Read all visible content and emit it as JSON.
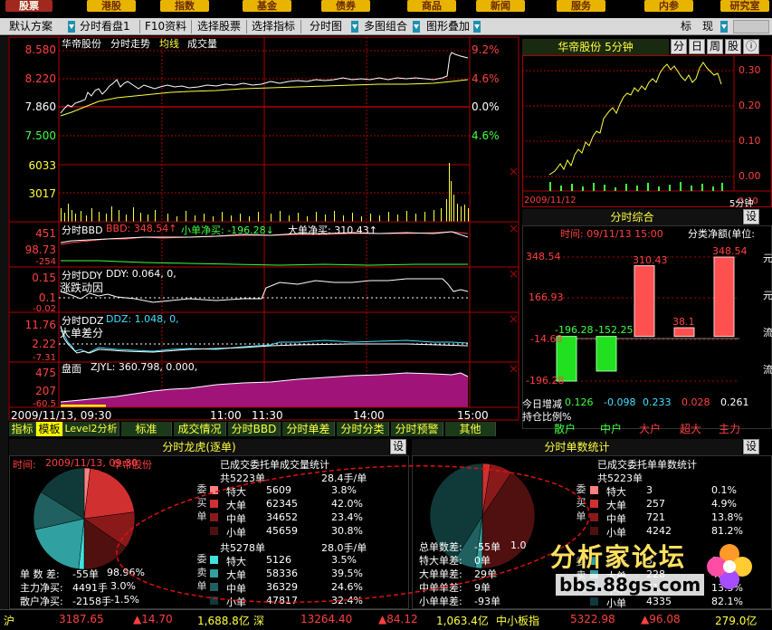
{
  "menubar": {
    "items": [
      "股票",
      "港股",
      "指数",
      "基金",
      "债券",
      "商品",
      "新闻",
      "服务",
      "内参",
      "研究室"
    ],
    "active": 0
  },
  "toolbar": {
    "scheme": "默认方案",
    "items": [
      "分时看盘1",
      "F10资料",
      "选择股票",
      "选择指标",
      "分时图",
      "多图组合",
      "图形叠加"
    ],
    "right_buttons": [
      "标",
      "现"
    ]
  },
  "main_chart": {
    "title": "华帝股份",
    "mode": "分时走势",
    "avg_label": "均线",
    "vol_label": "成交量",
    "price_labels": [
      "8.580",
      "8.220",
      "7.860",
      "7.500"
    ],
    "pct_labels": [
      "9.2%",
      "4.6%",
      "0.0%",
      "4.6%"
    ],
    "vol_labels": [
      "6033",
      "3017"
    ],
    "colors": {
      "price_line": "#ffffff",
      "avg_line": "#ffff40",
      "axis_red": "#b00000",
      "up": "#ff4040",
      "down": "#40ff40"
    }
  },
  "bbd": {
    "label": "分时BBD",
    "bbd_text": "BBD: 348.54↑",
    "small_text": "小单净买: -196.28↓",
    "big_text": "大单净买: 310.43↑",
    "y_labels": [
      "451",
      "98.73",
      "-254"
    ]
  },
  "ddy": {
    "label": "分时DDY",
    "value_text": "DDY: 0.064, 0,",
    "sub_title": "涨跌动因",
    "y_labels": [
      "0.15",
      "0.1",
      "-0.02"
    ]
  },
  "ddz": {
    "label": "分时DDZ",
    "value_text": "DDZ: 1.048, 0,",
    "sub_title": "大单差分",
    "y_labels": [
      "11.76",
      "2.22",
      "-7.31"
    ]
  },
  "pan": {
    "label": "盘面",
    "value_text": "ZJYL: 360.798, 0.000,",
    "y_labels": [
      "475",
      "207",
      "-60.5"
    ]
  },
  "time_axis": {
    "date": "2009/11/13, 09:30",
    "ticks": [
      "11:00",
      "11:30",
      "14:00",
      "15:00"
    ]
  },
  "tabs": [
    "指标",
    "模板",
    "Level2分析",
    "标准",
    "成交情况",
    "分时BBD",
    "分时单差",
    "分时分类",
    "分时预警",
    "其他"
  ],
  "active_tab": 1,
  "right_top": {
    "title": "华帝股份  5分钟",
    "buttons": [
      "分",
      "日",
      "周",
      "股",
      "ⓘ"
    ],
    "y_labels": [
      "0.30",
      "0.20",
      "0.10",
      "0.00",
      "-0.10"
    ],
    "date": "2009/11/12",
    "period": "5分钟"
  },
  "right_mid": {
    "title": "分时综合",
    "set": "设",
    "time_text": "时间: 09/11/13 15:00",
    "unit_text": "分类净额(单位:",
    "y_labels": [
      "348.54",
      "166.93",
      "-14.68",
      "-196.28"
    ],
    "side_chars": [
      "元",
      "元",
      "流",
      "流"
    ],
    "values_bars": [
      -196.28,
      -152.25,
      310.43,
      38.1,
      348.54
    ],
    "bar_labels": [
      "-196.28",
      "-152.25",
      "310.43",
      "38.1",
      "348.54"
    ],
    "increase_label": "今日增减",
    "increase_values": [
      "0.126",
      "-0.098",
      "0.233",
      "0.028",
      "0.261"
    ],
    "hold_label": "持仓比例%",
    "categories": [
      "散户",
      "中户",
      "大户",
      "超大",
      "主力"
    ]
  },
  "dragon": {
    "title": "分时龙虎(逐单)",
    "set": "设",
    "time_label": "时间:",
    "time_value": "2009/11/13, 09:30",
    "stock": "华帝股份",
    "pie_slices": [
      {
        "name": "特大",
        "pct": 3.8,
        "color": "#ff8080"
      },
      {
        "name": "大单",
        "pct": 42.0,
        "color": "#d03030"
      },
      {
        "name": "中单",
        "pct": 23.4,
        "color": "#8a1a1a"
      },
      {
        "name": "小单",
        "pct": 30.8,
        "color": "#501010"
      }
    ],
    "pie_slices_sell": [
      {
        "name": "特大",
        "pct": 3.5,
        "color": "#40e0e0"
      },
      {
        "name": "大单",
        "pct": 39.5,
        "color": "#30a0a0"
      },
      {
        "name": "中单",
        "pct": 24.6,
        "color": "#206060"
      },
      {
        "name": "小单",
        "pct": 32.4,
        "color": "#103a3a"
      }
    ],
    "summary": [
      {
        "k": "单 数 差:",
        "v": "-55单",
        "p": "98.96%"
      },
      {
        "k": "主力净买:",
        "v": "4491手",
        "p": "3.0%"
      },
      {
        "k": "散户净买:",
        "v": "-2158手",
        "p": "-1.5%"
      }
    ],
    "stats_title": "已成交委托单成交量统计",
    "buy_header": "共5223单",
    "buy_avg": "28.4手/单",
    "buy_rows": [
      {
        "name": "特大",
        "v": "5609",
        "p": "3.8%",
        "color": "#ff8080"
      },
      {
        "name": "大单",
        "v": "62345",
        "p": "42.0%",
        "color": "#d03030"
      },
      {
        "name": "中单",
        "v": "34652",
        "p": "23.4%",
        "color": "#8a1a1a"
      },
      {
        "name": "小单",
        "v": "45659",
        "p": "30.8%",
        "color": "#501010"
      }
    ],
    "buy_side": [
      "委",
      "买",
      "单"
    ],
    "sell_header": "共5278单",
    "sell_avg": "28.0手/单",
    "sell_rows": [
      {
        "name": "特大",
        "v": "5126",
        "p": "3.5%",
        "color": "#40e0e0"
      },
      {
        "name": "大单",
        "v": "58336",
        "p": "39.5%",
        "color": "#30a0a0"
      },
      {
        "name": "中单",
        "v": "36329",
        "p": "24.6%",
        "color": "#206060"
      },
      {
        "name": "小单",
        "v": "47817",
        "p": "32.4%",
        "color": "#103a3a"
      }
    ],
    "sell_side": [
      "委",
      "卖",
      "单"
    ]
  },
  "count": {
    "title": "分时单数统计",
    "set": "设",
    "summary": [
      {
        "k": "总单数差:",
        "v": "-55单",
        "p": "1.0"
      },
      {
        "k": "特大单差:",
        "v": "0单"
      },
      {
        "k": "大单单差:",
        "v": "29单"
      },
      {
        "k": "中单单差:",
        "v": "9单"
      },
      {
        "k": "小单单差:",
        "v": "-93单"
      }
    ],
    "stats_title": "已成交委托单单数统计",
    "buy_header": "共5223单",
    "buy_rows": [
      {
        "name": "特大",
        "v": "3",
        "p": "0.1%",
        "color": "#ff8080"
      },
      {
        "name": "大单",
        "v": "257",
        "p": "4.9%",
        "color": "#d03030"
      },
      {
        "name": "中单",
        "v": "721",
        "p": "13.8%",
        "color": "#8a1a1a"
      },
      {
        "name": "小单",
        "v": "4242",
        "p": "81.2%",
        "color": "#501010"
      }
    ],
    "buy_side": [
      "委",
      "买",
      "单"
    ],
    "sell_rows": [
      {
        "name": "特大",
        "v": "3",
        "p": "0.1%",
        "color": "#40e0e0"
      },
      {
        "name": "大单",
        "v": "228",
        "p": "4.3%",
        "color": "#30a0a0"
      },
      {
        "name": "中单",
        "v": "712",
        "p": "13.5%",
        "color": "#206060"
      },
      {
        "name": "小单",
        "v": "4335",
        "p": "82.1%",
        "color": "#103a3a"
      }
    ],
    "sell_side": [
      "委",
      "卖",
      "单"
    ]
  },
  "watermark": {
    "title": "分析家论坛",
    "url": "bbs.88gs.com"
  },
  "statusbar": {
    "items": [
      {
        "t": "沪",
        "c": "#ffff40"
      },
      {
        "t": "3187.65",
        "c": "#ff4040"
      },
      {
        "t": "▲14.70",
        "c": "#ff4040"
      },
      {
        "t": "1,688.8亿",
        "c": "#ffff40"
      },
      {
        "t": "深",
        "c": "#ffff40"
      },
      {
        "t": "13264.40",
        "c": "#ff4040"
      },
      {
        "t": "▲84.12",
        "c": "#ff4040"
      },
      {
        "t": "1,063.4亿",
        "c": "#ffff40"
      },
      {
        "t": "中小板指",
        "c": "#ffff40"
      },
      {
        "t": "5322.98",
        "c": "#ff4040"
      },
      {
        "t": "▲96.08",
        "c": "#ff4040"
      },
      {
        "t": "279.0亿",
        "c": "#ffff40"
      }
    ]
  }
}
